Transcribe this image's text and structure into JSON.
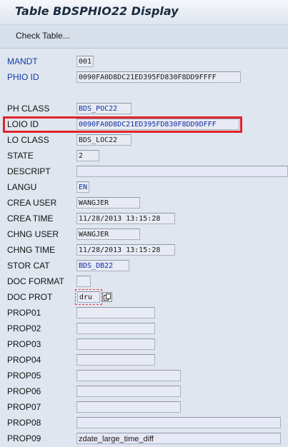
{
  "window": {
    "title": "Table BDSPHIO22 Display"
  },
  "toolbar": {
    "check_table": "Check Table..."
  },
  "fields": [
    {
      "label": "MANDT",
      "value": "001",
      "link": true
    },
    {
      "label": "PHIO ID",
      "value": "0090FA0D8DC21ED395FD830F8DD9FFFF",
      "link": true
    },
    {
      "label": "PH CLASS",
      "value": "BDS_POC22"
    },
    {
      "label": "LOIO ID",
      "value": "0090FA0D8DC21ED395FD830F8DD9DFFF",
      "highlighted": true
    },
    {
      "label": "LO CLASS",
      "value": "BDS_LOC22"
    },
    {
      "label": "STATE",
      "value": "2"
    },
    {
      "label": "DESCRIPT",
      "value": ""
    },
    {
      "label": "LANGU",
      "value": "EN"
    },
    {
      "label": "CREA USER",
      "value": "WANGJER"
    },
    {
      "label": "CREA TIME",
      "value": "11/28/2013 13:15:28"
    },
    {
      "label": "CHNG USER",
      "value": "WANGJER"
    },
    {
      "label": "CHNG TIME",
      "value": "11/28/2013 13:15:28"
    },
    {
      "label": "STOR CAT",
      "value": "BDS_DB22"
    },
    {
      "label": "DOC FORMAT",
      "value": ""
    },
    {
      "label": "DOC PROT",
      "value": "dru"
    },
    {
      "label": "PROP01",
      "value": ""
    },
    {
      "label": "PROP02",
      "value": ""
    },
    {
      "label": "PROP03",
      "value": ""
    },
    {
      "label": "PROP04",
      "value": ""
    },
    {
      "label": "PROP05",
      "value": ""
    },
    {
      "label": "PROP06",
      "value": ""
    },
    {
      "label": "PROP07",
      "value": ""
    },
    {
      "label": "PROP08",
      "value": ""
    },
    {
      "label": "PROP09",
      "value": "zdate_large_time_diff"
    }
  ],
  "icons": {
    "doc_prot_action": "copy-icon"
  },
  "colors": {
    "highlight": "#e2232b",
    "link": "#1239a8",
    "field_bg": "#e8eaf4"
  }
}
